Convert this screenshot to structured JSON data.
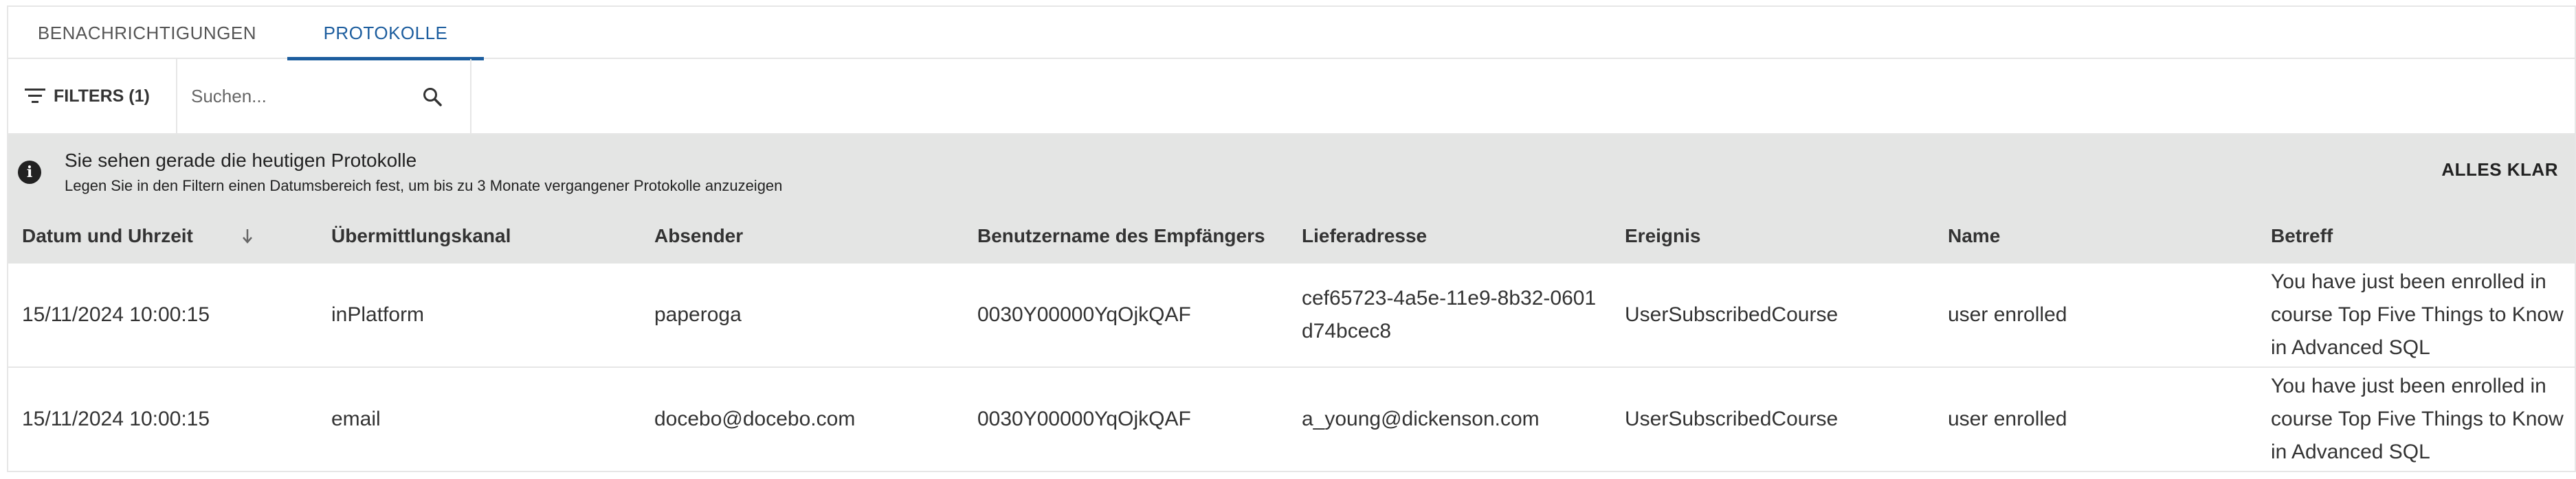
{
  "tabs": [
    {
      "label": "BENACHRICHTIGUNGEN",
      "active": false
    },
    {
      "label": "PROTOKOLLE",
      "active": true
    }
  ],
  "toolbar": {
    "filters_label": "FILTERS (1)",
    "search_placeholder": "Suchen...",
    "search_value": ""
  },
  "banner": {
    "title": "Sie sehen gerade die heutigen Protokolle",
    "subtitle": "Legen Sie in den Filtern einen Datumsbereich fest, um bis zu 3 Monate vergangener Protokolle anzuzeigen",
    "dismiss_label": "ALLES KLAR"
  },
  "table": {
    "columns": [
      "Datum und Uhrzeit",
      "Übermittlungskanal",
      "Absender",
      "Benutzername des Empfängers",
      "Lieferadresse",
      "Ereignis",
      "Name",
      "Betreff"
    ],
    "sort_column": "Datum und Uhrzeit",
    "sort_direction": "descending",
    "rows": [
      [
        "15/11/2024 10:00:15",
        "inPlatform",
        "paperoga",
        "0030Y00000YqOjkQAF",
        "cef65723-4a5e-11e9-8b32-0601d74bcec8",
        "UserSubscribedCourse",
        "user enrolled",
        "You have just been enrolled in course Top Five Things to Know in Advanced SQL"
      ],
      [
        "15/11/2024 10:00:15",
        "email",
        "docebo@docebo.com",
        "0030Y00000YqOjkQAF",
        "a_young@dickenson.com",
        "UserSubscribedCourse",
        "user enrolled",
        "You have just been enrolled in course Top Five Things to Know in Advanced SQL"
      ]
    ]
  },
  "colors": {
    "accent": "#1c5d9e",
    "banner_bg": "#e4e5e4",
    "border": "#e6e6e6",
    "text": "#333333"
  },
  "icons": [
    "filter-icon",
    "search-icon",
    "info-icon",
    "sort-arrow-down-icon"
  ]
}
